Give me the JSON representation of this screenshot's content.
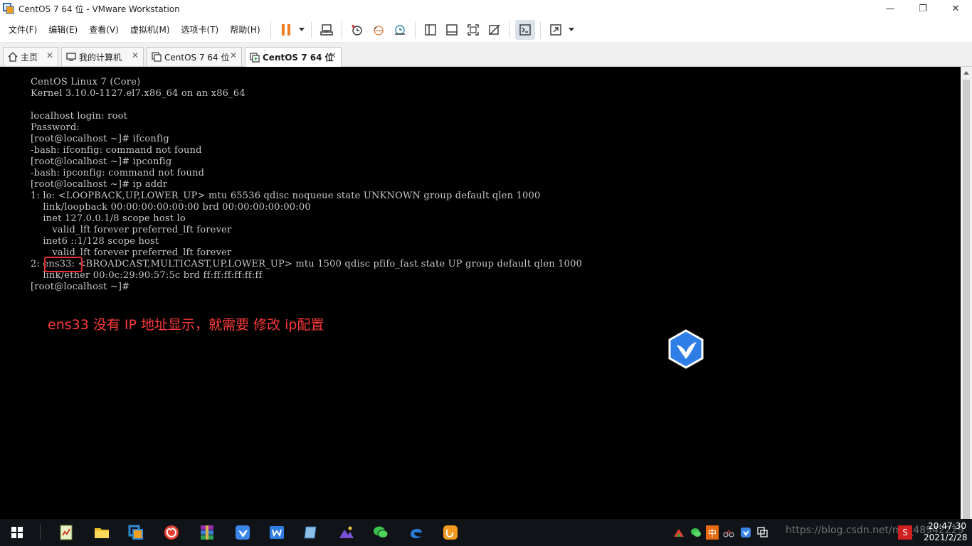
{
  "window": {
    "title": "CentOS 7 64 位 - VMware Workstation",
    "controls": {
      "minimize": "—",
      "restore": "❐",
      "close": "✕"
    }
  },
  "menu": [
    "文件(F)",
    "编辑(E)",
    "查看(V)",
    "虚拟机(M)",
    "选项卡(T)",
    "帮助(H)"
  ],
  "tabs": [
    {
      "label": "主页",
      "icon": "home-icon"
    },
    {
      "label": "我的计算机",
      "icon": "computer-icon"
    },
    {
      "label": "CentOS 7 64 位",
      "icon": "vm-icon"
    },
    {
      "label": "CentOS 7 64 位",
      "icon": "vm-running-icon",
      "active": true
    }
  ],
  "terminal": {
    "lines": [
      "CentOS Linux 7 (Core)",
      "Kernel 3.10.0-1127.el7.x86_64 on an x86_64",
      "",
      "localhost login: root",
      "Password:",
      "[root@localhost ~]# ifconfig",
      "-bash: ifconfig: command not found",
      "[root@localhost ~]# ipconfig",
      "-bash: ipconfig: command not found",
      "[root@localhost ~]# ip addr",
      "1: lo: <LOOPBACK,UP,LOWER_UP> mtu 65536 qdisc noqueue state UNKNOWN group default qlen 1000",
      "    link/loopback 00:00:00:00:00:00 brd 00:00:00:00:00:00",
      "    inet 127.0.0.1/8 scope host lo",
      "       valid_lft forever preferred_lft forever",
      "    inet6 ::1/128 scope host",
      "       valid_lft forever preferred_lft forever",
      "2: ens33: <BROADCAST,MULTICAST,UP,LOWER_UP> mtu 1500 qdisc pfifo_fast state UP group default qlen 1000",
      "    link/ether 00:0c:29:90:57:5c brd ff:ff:ff:ff:ff:ff",
      "[root@localhost ~]#"
    ]
  },
  "annotation": "ens33 没有 IP 地址显示，就需要 修改 ip配置",
  "taskbar": {
    "clock_time": "20:47:30",
    "clock_date": "2021/2/28",
    "watermark": "https://blog.csdn.net/m0_48942229",
    "tray_ime": "中",
    "tray_s": "S"
  },
  "colors": {
    "accent_orange": "#f07c20",
    "annotation_red": "#ff3b3b",
    "console_bg": "#000000",
    "terminal_text": "#c8c8c8"
  }
}
